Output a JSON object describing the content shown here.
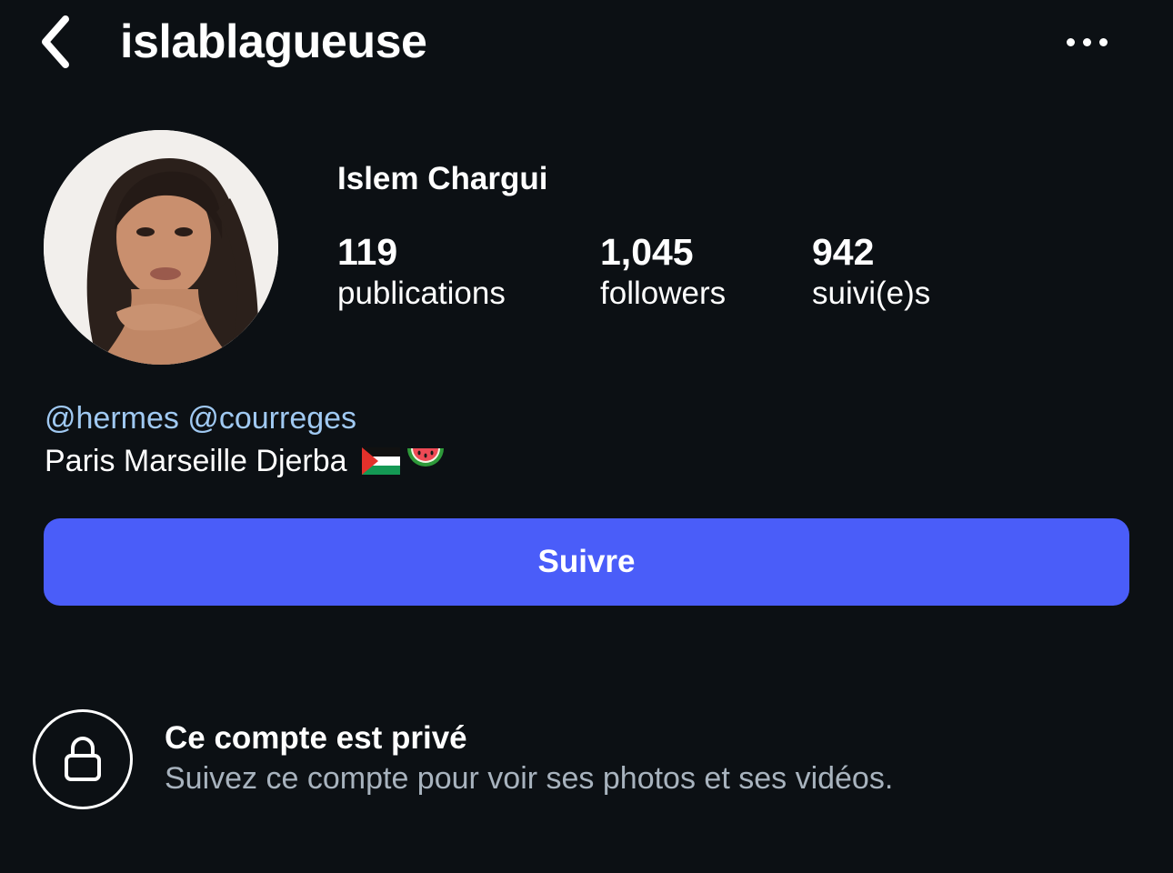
{
  "header": {
    "username": "islablagueuse",
    "back_icon": "chevron-left-icon",
    "more_icon": "more-horizontal-icon"
  },
  "profile": {
    "display_name": "Islem Chargui",
    "stats": {
      "posts": {
        "value": "119",
        "label": "publications"
      },
      "followers": {
        "value": "1,045",
        "label": "followers"
      },
      "following": {
        "value": "942",
        "label": "suivi(e)s"
      }
    },
    "bio": {
      "mentions": [
        "@hermes",
        "@courreges"
      ],
      "text": "Paris Marseille Djerba",
      "emojis": [
        "palestine-flag-icon",
        "watermelon-icon"
      ]
    }
  },
  "follow_button": {
    "label": "Suivre",
    "color": "#4a5df9"
  },
  "private_notice": {
    "icon": "lock-icon",
    "title": "Ce compte est privé",
    "subtitle": "Suivez ce compte pour voir ses photos et ses vidéos."
  },
  "colors": {
    "background": "#0c1014",
    "mention": "#a0c9f2",
    "secondary_text": "#a8b3be"
  }
}
